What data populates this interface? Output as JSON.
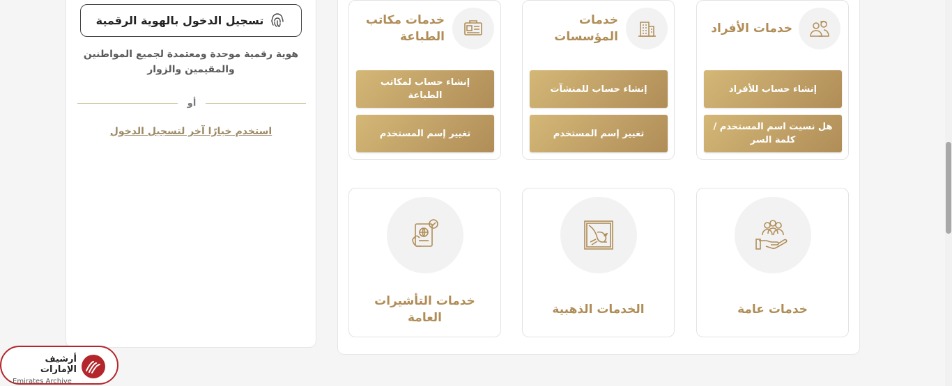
{
  "login": {
    "uaepass_label": "تسجيل الدخول بالهوية الرقمية",
    "tagline": "هوية رقمية موحدة ومعتمدة لجميع المواطنين والمقيمين والزوار",
    "or": "أو",
    "alt_link": "استخدم خيارًا آخر لتسجيل الدخول"
  },
  "services": {
    "individuals": {
      "title": "خدمات الأفراد",
      "icon": "people-icon",
      "buttons": [
        "إنشاء حساب للأفراد",
        "هل نسيت اسم المستخدم / كلمة السر"
      ]
    },
    "establishments": {
      "title": "خدمات المؤسسات",
      "icon": "building-icon",
      "buttons": [
        "إنشاء حساب للمنشآت",
        "تغيير إسم المستخدم"
      ]
    },
    "typing_offices": {
      "title": "خدمات مكاتب الطباعة",
      "icon": "id-card-icon",
      "buttons": [
        "إنشاء حساب لمكاتب الطباعة",
        "تغيير إسم المستخدم"
      ]
    },
    "general": {
      "title": "خدمات عامة",
      "icon": "hand-people-icon"
    },
    "golden": {
      "title": "الخدمات الذهبية",
      "icon": "falcon-icon"
    },
    "visa": {
      "title": "خدمات التأشيرات العامة",
      "icon": "passport-icon"
    }
  },
  "watermark": {
    "arabic": "أرشيف الإمارات",
    "english": "Emirates Archive"
  },
  "colors": {
    "gold": "#b08d57",
    "gold_light": "#d4b877",
    "watermark_red": "#b3262b"
  }
}
